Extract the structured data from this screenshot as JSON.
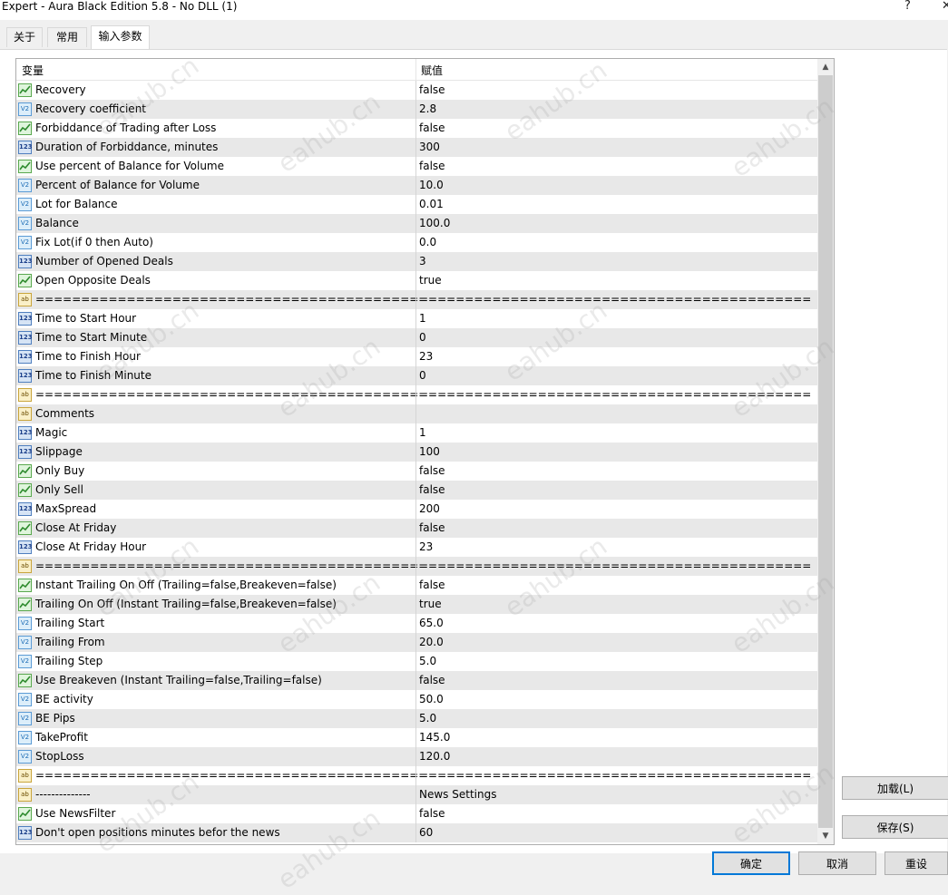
{
  "window": {
    "title": "Expert - Aura Black Edition 5.8 - No DLL (1)",
    "help": "?",
    "close": "✕"
  },
  "tabs": [
    {
      "label": "关于"
    },
    {
      "label": "常用"
    },
    {
      "label": "输入参数"
    }
  ],
  "grid": {
    "col_variable": "变量",
    "col_value": "赋值"
  },
  "rows": [
    {
      "type": "bool",
      "name": "Recovery",
      "value": "false"
    },
    {
      "type": "dbl",
      "name": "Recovery coefficient",
      "value": "2.8"
    },
    {
      "type": "bool",
      "name": "Forbiddance of Trading after Loss",
      "value": "false"
    },
    {
      "type": "int",
      "name": "Duration of Forbiddance, minutes",
      "value": "300"
    },
    {
      "type": "bool",
      "name": "Use percent of Balance for Volume",
      "value": "false"
    },
    {
      "type": "dbl",
      "name": "Percent of Balance for Volume",
      "value": "10.0"
    },
    {
      "type": "dbl",
      "name": "Lot for Balance",
      "value": "0.01"
    },
    {
      "type": "dbl",
      "name": "Balance",
      "value": "100.0"
    },
    {
      "type": "dbl",
      "name": "Fix Lot(if 0 then Auto)",
      "value": "0.0"
    },
    {
      "type": "int",
      "name": "Number of Opened Deals",
      "value": "3"
    },
    {
      "type": "bool",
      "name": "Open Opposite Deals",
      "value": "true"
    },
    {
      "type": "str",
      "name": "===========================================",
      "value": "==========================================="
    },
    {
      "type": "int",
      "name": "Time to Start Hour",
      "value": "1"
    },
    {
      "type": "int",
      "name": "Time to Start Minute",
      "value": "0"
    },
    {
      "type": "int",
      "name": "Time to Finish Hour",
      "value": "23"
    },
    {
      "type": "int",
      "name": "Time to Finish Minute",
      "value": "0"
    },
    {
      "type": "str",
      "name": "===========================================",
      "value": "==========================================="
    },
    {
      "type": "str",
      "name": "Comments",
      "value": ""
    },
    {
      "type": "int",
      "name": "Magic",
      "value": "1"
    },
    {
      "type": "int",
      "name": "Slippage",
      "value": "100"
    },
    {
      "type": "bool",
      "name": "Only Buy",
      "value": "false"
    },
    {
      "type": "bool",
      "name": "Only Sell",
      "value": "false"
    },
    {
      "type": "int",
      "name": "MaxSpread",
      "value": "200"
    },
    {
      "type": "bool",
      "name": "Close At Friday",
      "value": "false"
    },
    {
      "type": "int",
      "name": "Close At Friday Hour",
      "value": "23"
    },
    {
      "type": "str",
      "name": "===========================================",
      "value": "==========================================="
    },
    {
      "type": "bool",
      "name": "Instant Trailing On Off (Trailing=false,Breakeven=false)",
      "value": "false"
    },
    {
      "type": "bool",
      "name": "Trailing On Off (Instant Trailing=false,Breakeven=false)",
      "value": "true"
    },
    {
      "type": "dbl",
      "name": "Trailing Start",
      "value": "65.0"
    },
    {
      "type": "dbl",
      "name": "Trailing From",
      "value": "20.0"
    },
    {
      "type": "dbl",
      "name": "Trailing Step",
      "value": "5.0"
    },
    {
      "type": "bool",
      "name": "Use Breakeven (Instant Trailing=false,Trailing=false)",
      "value": "false"
    },
    {
      "type": "dbl",
      "name": "BE activity",
      "value": "50.0"
    },
    {
      "type": "dbl",
      "name": "BE Pips",
      "value": "5.0"
    },
    {
      "type": "dbl",
      "name": "TakeProfit",
      "value": "145.0"
    },
    {
      "type": "dbl",
      "name": "StopLoss",
      "value": "120.0"
    },
    {
      "type": "str",
      "name": "===========================================",
      "value": "==========================================="
    },
    {
      "type": "str",
      "name": "--------------",
      "value": "News Settings"
    },
    {
      "type": "bool",
      "name": "Use NewsFilter",
      "value": "false"
    },
    {
      "type": "int",
      "name": "Don't open positions minutes befor the news",
      "value": "60"
    }
  ],
  "icon_glyphs": {
    "dbl": "V2",
    "int": "123",
    "str": "ab"
  },
  "side_buttons": {
    "load": "加载(L)",
    "save": "保存(S)"
  },
  "bottom_buttons": {
    "ok": "确定",
    "cancel": "取消",
    "reset": "重设"
  },
  "scrollbar": {
    "up": "▲",
    "down": "▼"
  },
  "watermark": "eahub.cn"
}
